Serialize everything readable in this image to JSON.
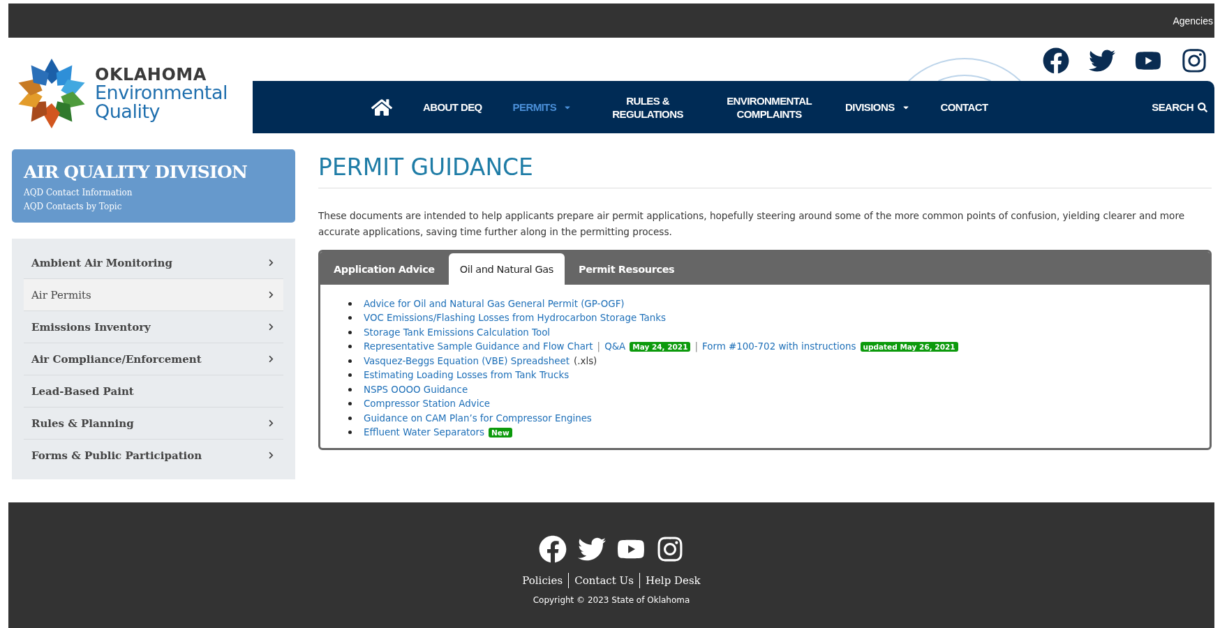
{
  "top_bar": {
    "link": "Agencies"
  },
  "logo": {
    "line_1": "OKLAHOMA",
    "line_2": "Environmental",
    "line_3": "Quality"
  },
  "social": [
    {
      "kind": "facebook"
    },
    {
      "kind": "twitter"
    },
    {
      "kind": "youtube"
    },
    {
      "kind": "instagram"
    }
  ],
  "nav": {
    "items": [
      {
        "kind": "home",
        "selected": false,
        "dropdown": false
      },
      {
        "kind": "link",
        "label": "ABOUT DEQ",
        "selected": false,
        "dropdown": false
      },
      {
        "kind": "link",
        "label": "PERMITS",
        "selected": true,
        "dropdown": true
      },
      {
        "kind": "link",
        "label": "RULES & REGULATIONS",
        "selected": false,
        "dropdown": false
      },
      {
        "kind": "link",
        "label": "ENVIRONMENTAL COMPLAINTS",
        "selected": false,
        "dropdown": false
      },
      {
        "kind": "link",
        "label": "DIVISIONS",
        "selected": false,
        "dropdown": true
      },
      {
        "kind": "link",
        "label": "CONTACT",
        "selected": false,
        "dropdown": false
      }
    ],
    "search": "SEARCH"
  },
  "sidebar": {
    "title": "AIR QUALITY DIVISION",
    "links": [
      "AQD Contact Information",
      "AQD Contacts by Topic"
    ],
    "menu": [
      {
        "label": "Ambient Air Monitoring",
        "selected": false,
        "submenu": true
      },
      {
        "label": "Air Permits",
        "selected": true,
        "submenu": true
      },
      {
        "label": "Emissions Inventory",
        "selected": false,
        "submenu": true
      },
      {
        "label": "Air Compliance/Enforcement",
        "selected": false,
        "submenu": true
      },
      {
        "label": "Lead-Based Paint",
        "selected": false,
        "submenu": false
      },
      {
        "label": "Rules & Planning",
        "selected": false,
        "submenu": true
      },
      {
        "label": "Forms & Public Participation",
        "selected": false,
        "submenu": true
      }
    ]
  },
  "page": {
    "title": "PERMIT GUIDANCE",
    "intro": "These documents are intended to help applicants prepare air permit applications, hopefully steering around some of the more common points of confusion, yielding clearer and more accurate applications, saving time further along in the permitting process."
  },
  "tabs": [
    {
      "label": "Application Advice",
      "selected": false
    },
    {
      "label": "Oil and Natural Gas",
      "selected": true
    },
    {
      "label": "Permit Resources",
      "selected": false
    }
  ],
  "documents": [
    [
      {
        "kind": "link",
        "text": "Advice for Oil and Natural Gas General Permit (GP-OGF)"
      }
    ],
    [
      {
        "kind": "link",
        "text": "VOC Emissions/Flashing Losses from Hydrocarbon Storage Tanks"
      }
    ],
    [
      {
        "kind": "link",
        "text": "Storage Tank Emissions Calculation Tool"
      }
    ],
    [
      {
        "kind": "link",
        "text": "Representative Sample Guidance and Flow Chart"
      },
      {
        "kind": "separator",
        "text": "|"
      },
      {
        "kind": "link",
        "text": "Q&A"
      },
      {
        "kind": "badge",
        "text": "May 24, 2021"
      },
      {
        "kind": "separator",
        "text": "|"
      },
      {
        "kind": "link",
        "text": "Form #100-702 with instructions"
      },
      {
        "kind": "badge",
        "text": "updated May 26, 2021"
      }
    ],
    [
      {
        "kind": "link",
        "text": "Vasquez-Beggs Equation (VBE) Spreadsheet"
      },
      {
        "kind": "text",
        "text": "(.xls)"
      }
    ],
    [
      {
        "kind": "link",
        "text": "Estimating Loading Losses from Tank Trucks"
      }
    ],
    [
      {
        "kind": "link",
        "text": "NSPS OOOO Guidance"
      }
    ],
    [
      {
        "kind": "link",
        "text": "Compressor Station Advice"
      }
    ],
    [
      {
        "kind": "link",
        "text": "Guidance on CAM Plan’s for Compressor Engines"
      }
    ],
    [
      {
        "kind": "link",
        "text": "Effluent Water Separators"
      },
      {
        "kind": "badge",
        "text": "New"
      }
    ]
  ],
  "footer": {
    "social": [
      {
        "kind": "facebook"
      },
      {
        "kind": "twitter"
      },
      {
        "kind": "youtube"
      },
      {
        "kind": "instagram"
      }
    ],
    "links": [
      "Policies",
      "Contact Us",
      "Help Desk"
    ],
    "copyright": "Copyright © 2023 State of Oklahoma"
  }
}
